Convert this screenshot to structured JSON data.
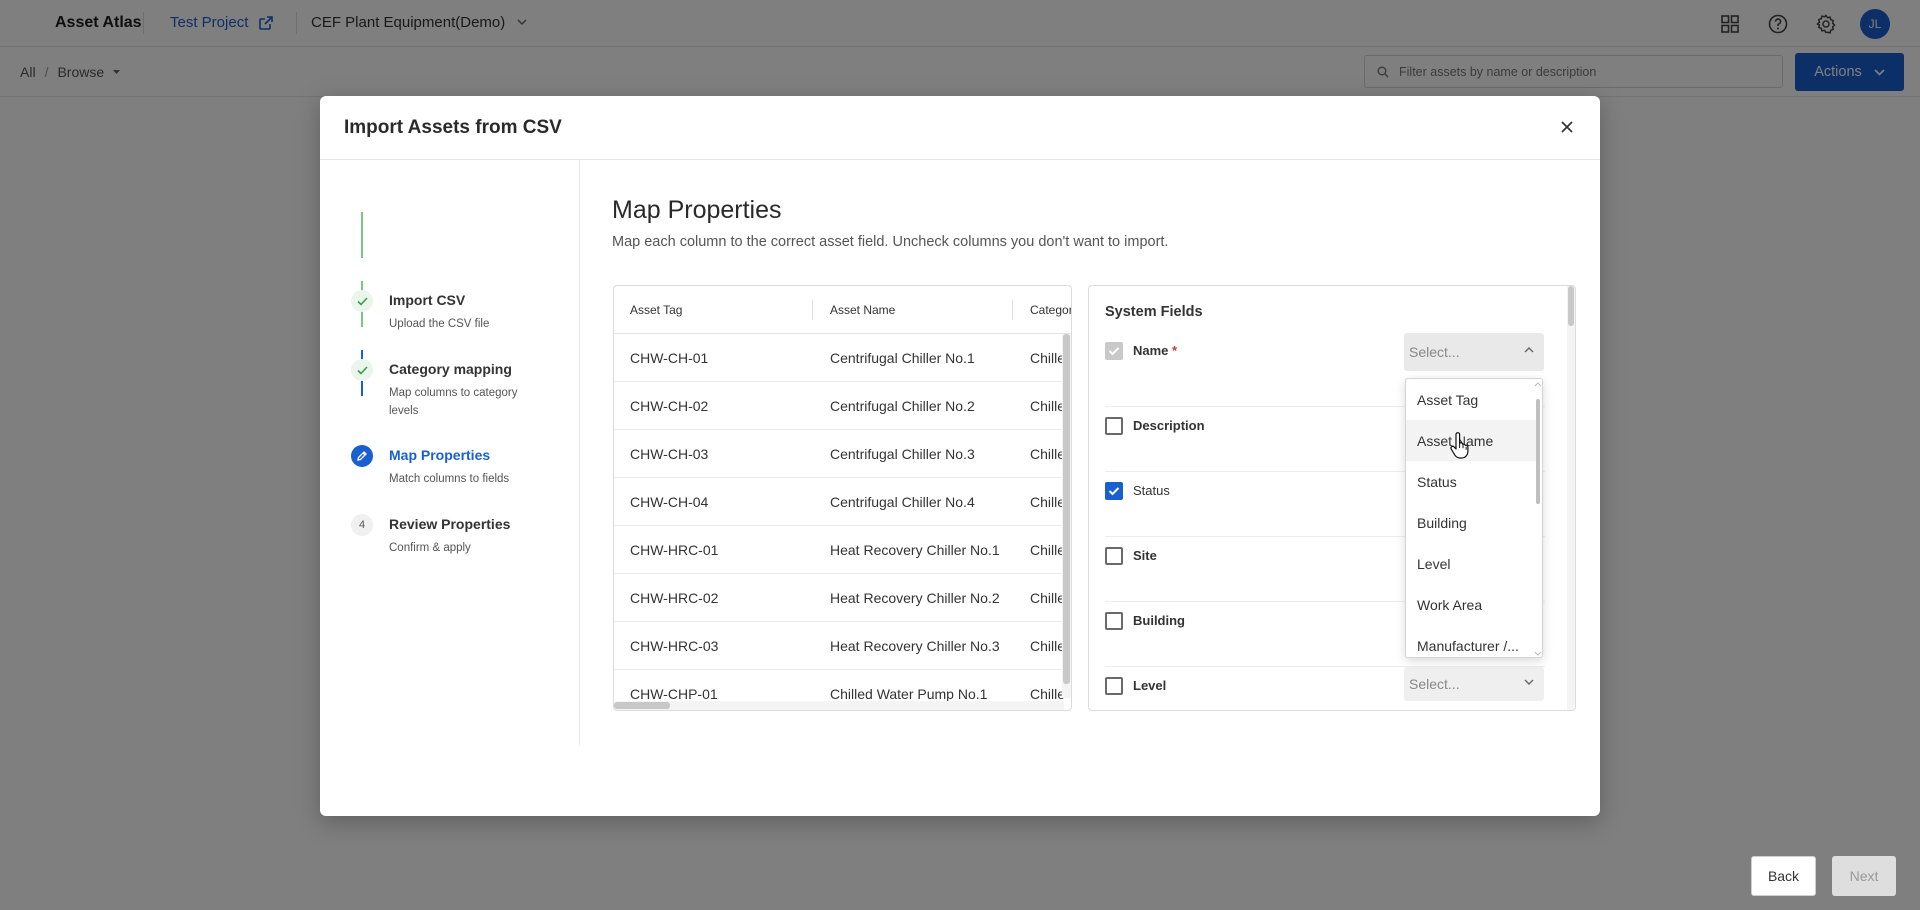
{
  "app": {
    "title": "Asset Atlas"
  },
  "topbar": {
    "project_name": "Test Project",
    "equipment_set": "CEF Plant Equipment(Demo)",
    "avatar_initials": "JL"
  },
  "breadcrumb": {
    "root": "All",
    "separator": "/",
    "current": "Browse"
  },
  "search": {
    "placeholder": "Filter assets by name or description"
  },
  "actions": {
    "label": "Actions"
  },
  "modal": {
    "title": "Import Assets from CSV",
    "steps": [
      {
        "title": "Import CSV",
        "subtitle": "Upload the CSV file",
        "state": "done"
      },
      {
        "title": "Category mapping",
        "subtitle": "Map columns to category levels",
        "state": "done"
      },
      {
        "title": "Map Properties",
        "subtitle": "Match columns to fields",
        "state": "active"
      },
      {
        "number": "4",
        "title": "Review Properties",
        "subtitle": "Confirm & apply",
        "state": "todo"
      }
    ],
    "section_title": "Map Properties",
    "section_desc": "Map each column to the correct asset field. Uncheck columns you don't want to import.",
    "table": {
      "columns": [
        "Asset Tag",
        "Asset Name",
        "Categor"
      ],
      "rows": [
        [
          "CHW-CH-01",
          "Centrifugal Chiller No.1",
          "Chille"
        ],
        [
          "CHW-CH-02",
          "Centrifugal Chiller No.2",
          "Chille"
        ],
        [
          "CHW-CH-03",
          "Centrifugal Chiller No.3",
          "Chille"
        ],
        [
          "CHW-CH-04",
          "Centrifugal Chiller No.4",
          "Chille"
        ],
        [
          "CHW-HRC-01",
          "Heat Recovery Chiller No.1",
          "Chille"
        ],
        [
          "CHW-HRC-02",
          "Heat Recovery Chiller No.2",
          "Chille"
        ],
        [
          "CHW-HRC-03",
          "Heat Recovery Chiller No.3",
          "Chille"
        ],
        [
          "CHW-CHP-01",
          "Chilled Water Pump No.1",
          "Chille"
        ]
      ]
    },
    "fields": {
      "title": "System Fields",
      "items": [
        {
          "label": "Name",
          "required_mark": "*",
          "state": "disabled-checked",
          "select": "Select..."
        },
        {
          "label": "Description",
          "state": "unchecked"
        },
        {
          "label": "Status",
          "state": "checked"
        },
        {
          "label": "Site",
          "state": "unchecked"
        },
        {
          "label": "Building",
          "state": "unchecked"
        },
        {
          "label": "Level",
          "state": "unchecked",
          "select": "Select..."
        }
      ]
    },
    "dropdown": {
      "options": [
        "Asset Tag",
        "Asset Name",
        "Status",
        "Building",
        "Level",
        "Work Area",
        "Manufacturer /..."
      ],
      "hovered": "Asset Name"
    },
    "buttons": {
      "back": "Back",
      "next": "Next"
    }
  },
  "colors": {
    "accent": "#1a5fd0",
    "done_check": "#3d9b4f",
    "required": "#d0342c"
  }
}
